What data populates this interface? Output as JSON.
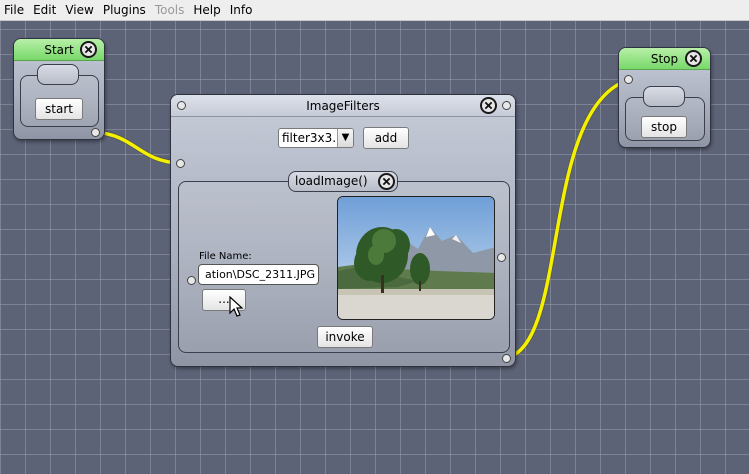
{
  "menu": {
    "items": [
      {
        "label": "File",
        "enabled": true
      },
      {
        "label": "Edit",
        "enabled": true
      },
      {
        "label": "View",
        "enabled": true
      },
      {
        "label": "Plugins",
        "enabled": true
      },
      {
        "label": "Tools",
        "enabled": false
      },
      {
        "label": "Help",
        "enabled": true
      },
      {
        "label": "Info",
        "enabled": true
      }
    ]
  },
  "start_node": {
    "title": "Start",
    "button_label": "start"
  },
  "stop_node": {
    "title": "Stop",
    "button_label": "stop"
  },
  "image_filters": {
    "title": "ImageFilters",
    "filter_select": {
      "selected": "filter3x3..."
    },
    "add_label": "add",
    "method": {
      "title": "loadImage()",
      "file_name_label": "File Name:",
      "file_name_value": "ation\\DSC_2311.JPG",
      "browse_label": "...",
      "invoke_label": "invoke"
    }
  },
  "colors": {
    "canvas": "#5d6377",
    "wire": "#f5f000",
    "title_green": "#78d86a"
  },
  "icons": {
    "close": "close-circle-icon",
    "cursor": "mouse-pointer-icon",
    "dropdown": "triangle-down-icon"
  }
}
